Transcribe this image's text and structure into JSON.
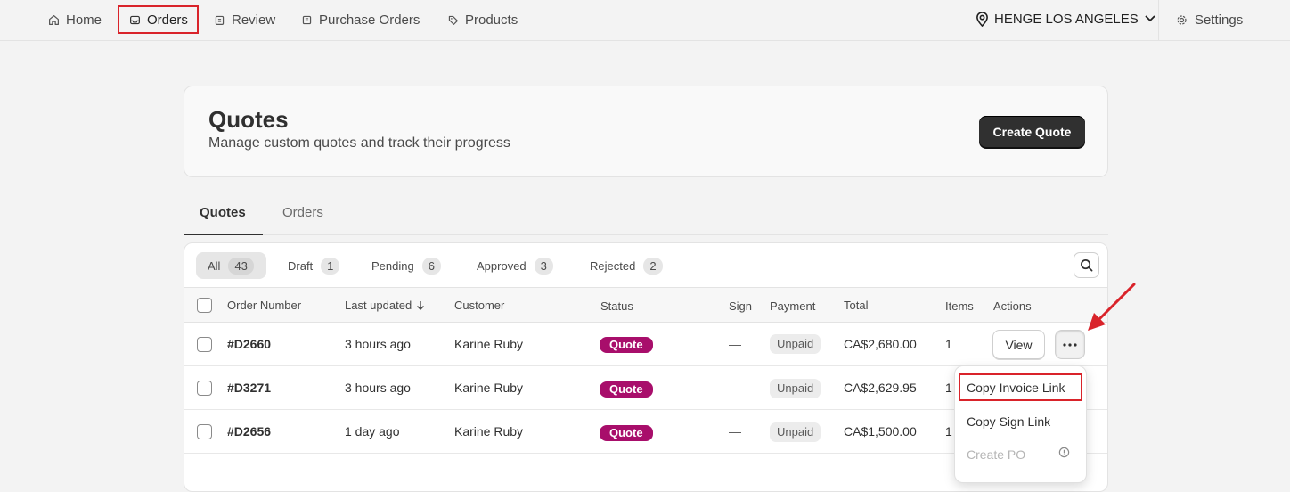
{
  "nav": {
    "items": [
      {
        "label": "Home",
        "icon": "home-icon"
      },
      {
        "label": "Orders",
        "icon": "inbox-icon"
      },
      {
        "label": "Review",
        "icon": "clipboard-icon"
      },
      {
        "label": "Purchase Orders",
        "icon": "receipt-icon"
      },
      {
        "label": "Products",
        "icon": "tag-icon"
      }
    ],
    "store": "HENGE LOS ANGELES",
    "settings": "Settings"
  },
  "header": {
    "title": "Quotes",
    "subtitle": "Manage custom quotes and track their progress",
    "create_label": "Create Quote"
  },
  "tabs": [
    "Quotes",
    "Orders"
  ],
  "filters": [
    {
      "label": "All",
      "count": "43"
    },
    {
      "label": "Draft",
      "count": "1"
    },
    {
      "label": "Pending",
      "count": "6"
    },
    {
      "label": "Approved",
      "count": "3"
    },
    {
      "label": "Rejected",
      "count": "2"
    }
  ],
  "columns": {
    "order_number": "Order Number",
    "last_updated": "Last updated",
    "customer": "Customer",
    "status": "Status",
    "sign": "Sign",
    "payment": "Payment",
    "total": "Total",
    "items": "Items",
    "actions": "Actions"
  },
  "rows": [
    {
      "order": "#D2660",
      "updated": "3 hours ago",
      "customer": "Karine Ruby",
      "status": "Quote",
      "sign": "—",
      "payment": "Unpaid",
      "total": "CA$2,680.00",
      "items": "1"
    },
    {
      "order": "#D3271",
      "updated": "3 hours ago",
      "customer": "Karine Ruby",
      "status": "Quote",
      "sign": "—",
      "payment": "Unpaid",
      "total": "CA$2,629.95",
      "items": "1"
    },
    {
      "order": "#D2656",
      "updated": "1 day ago",
      "customer": "Karine Ruby",
      "status": "Quote",
      "sign": "—",
      "payment": "Unpaid",
      "total": "CA$1,500.00",
      "items": "1"
    }
  ],
  "actions": {
    "view_label": "View"
  },
  "menu": {
    "copy_invoice": "Copy Invoice Link",
    "copy_sign": "Copy Sign Link",
    "create_po": "Create PO"
  },
  "colors": {
    "accent": "#303030",
    "quote_badge": "#a80e6b",
    "highlight": "#d9232a"
  }
}
